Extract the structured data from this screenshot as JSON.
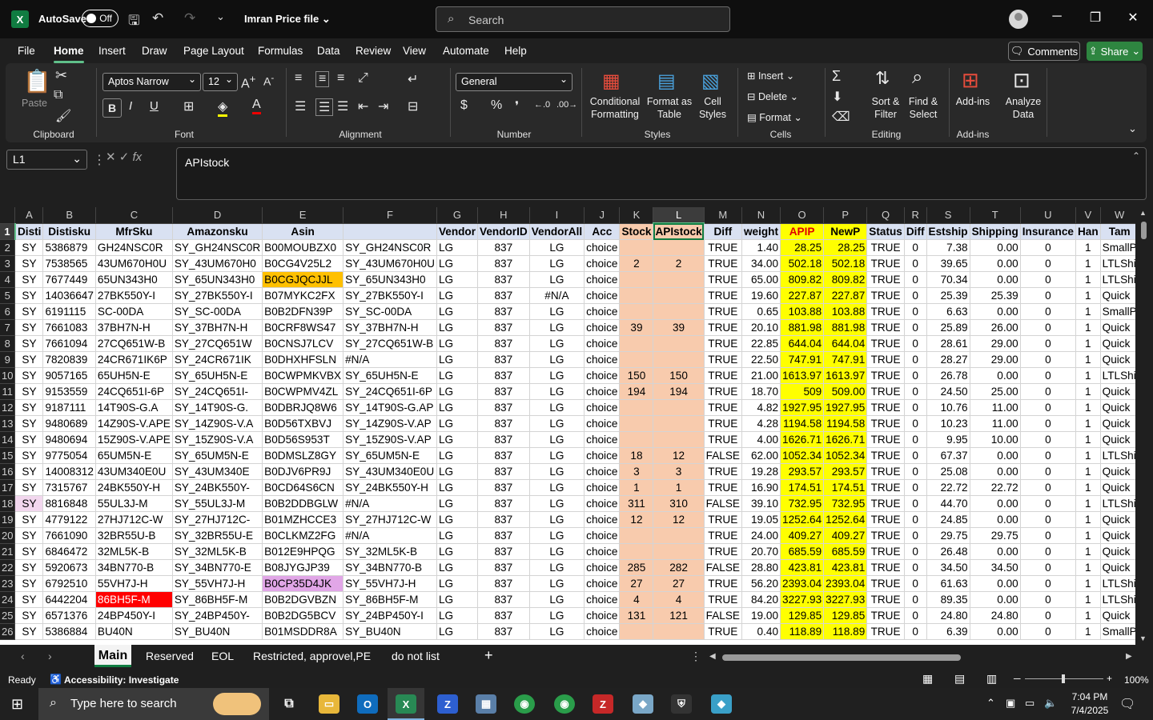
{
  "titlebar": {
    "autosave_label": "AutoSave",
    "autosave_state": "Off",
    "file_title": "Imran Price file",
    "search_placeholder": "Search"
  },
  "menu": {
    "items": [
      "File",
      "Home",
      "Insert",
      "Draw",
      "Page Layout",
      "Formulas",
      "Data",
      "Review",
      "View",
      "Automate",
      "Help"
    ],
    "comments": "Comments",
    "share": "Share"
  },
  "ribbon": {
    "clipboard": {
      "label": "Clipboard",
      "paste": "Paste"
    },
    "font": {
      "label": "Font",
      "name": "Aptos Narrow",
      "size": "12"
    },
    "alignment": {
      "label": "Alignment"
    },
    "number": {
      "label": "Number",
      "format": "General"
    },
    "styles": {
      "label": "Styles",
      "cond1": "Conditional",
      "cond2": "Formatting",
      "fmt1": "Format as",
      "fmt2": "Table",
      "cell1": "Cell",
      "cell2": "Styles"
    },
    "cells": {
      "label": "Cells",
      "insert": "Insert",
      "delete": "Delete",
      "format": "Format"
    },
    "editing": {
      "label": "Editing",
      "sort1": "Sort &",
      "sort2": "Filter",
      "find1": "Find &",
      "find2": "Select"
    },
    "addins": {
      "label": "Add-ins",
      "addins": "Add-ins",
      "analyze1": "Analyze",
      "analyze2": "Data"
    }
  },
  "formula_bar": {
    "name_box": "L1",
    "formula": "APIstock"
  },
  "grid": {
    "columns": [
      "A",
      "B",
      "C",
      "D",
      "E",
      "F",
      "G",
      "H",
      "I",
      "J",
      "K",
      "L",
      "M",
      "N",
      "O",
      "P",
      "Q",
      "R",
      "S",
      "T",
      "U",
      "V",
      "W"
    ],
    "header_row": [
      "Disti",
      "Distisku",
      "MfrSku",
      "Amazonsku",
      "Asin",
      "",
      "Vendor",
      "VendorID",
      "VendorAll",
      "Acc",
      "Stock",
      "APIstock",
      "Diff",
      "weight",
      "APIP",
      "NewP",
      "Status",
      "Diff",
      "Estship",
      "Shipping",
      "Insurance",
      "Han",
      "Tam"
    ],
    "rows": [
      [
        "2",
        "SY",
        "5386879",
        "GH24NSC0R",
        "SY_GH24NSC0R",
        "B00MOUBZX0",
        "SY_GH24NSC0R",
        "LG",
        "837",
        "LG",
        "choice",
        "",
        "",
        "TRUE",
        "1.40",
        "28.25",
        "28.25",
        "TRUE",
        "0",
        "7.38",
        "0.00",
        "0",
        "1",
        "SmallP"
      ],
      [
        "3",
        "SY",
        "7538565",
        "43UM670H0U",
        "SY_43UM670H0",
        "B0CG4V25L2",
        "SY_43UM670H0U",
        "LG",
        "837",
        "LG",
        "choice",
        "2",
        "2",
        "TRUE",
        "34.00",
        "502.18",
        "502.18",
        "TRUE",
        "0",
        "39.65",
        "0.00",
        "0",
        "1",
        "LTLShi"
      ],
      [
        "4",
        "SY",
        "7677449",
        "65UN343H0",
        "SY_65UN343H0",
        "B0CGJQCJJL",
        "SY_65UN343H0",
        "LG",
        "837",
        "LG",
        "choice",
        "",
        "",
        "TRUE",
        "65.00",
        "809.82",
        "809.82",
        "TRUE",
        "0",
        "70.34",
        "0.00",
        "0",
        "1",
        "LTLShi"
      ],
      [
        "5",
        "SY",
        "14036647",
        "27BK550Y-I",
        "SY_27BK550Y-I",
        "B07MYKC2FX",
        "SY_27BK550Y-I",
        "LG",
        "837",
        "#N/A",
        "choice",
        "",
        "",
        "TRUE",
        "19.60",
        "227.87",
        "227.87",
        "TRUE",
        "0",
        "25.39",
        "25.39",
        "0",
        "1",
        "Quick"
      ],
      [
        "6",
        "SY",
        "6191115",
        "SC-00DA",
        "SY_SC-00DA",
        "B0B2DFN39P",
        "SY_SC-00DA",
        "LG",
        "837",
        "LG",
        "choice",
        "",
        "",
        "TRUE",
        "0.65",
        "103.88",
        "103.88",
        "TRUE",
        "0",
        "6.63",
        "0.00",
        "0",
        "1",
        "SmallP"
      ],
      [
        "7",
        "SY",
        "7661083",
        "37BH7N-H",
        "SY_37BH7N-H",
        "B0CRF8WS47",
        "SY_37BH7N-H",
        "LG",
        "837",
        "LG",
        "choice",
        "39",
        "39",
        "TRUE",
        "20.10",
        "881.98",
        "881.98",
        "TRUE",
        "0",
        "25.89",
        "26.00",
        "0",
        "1",
        "Quick"
      ],
      [
        "8",
        "SY",
        "7661094",
        "27CQ651W-B",
        "SY_27CQ651W",
        "B0CNSJ7LCV",
        "SY_27CQ651W-B",
        "LG",
        "837",
        "LG",
        "choice",
        "",
        "",
        "TRUE",
        "22.85",
        "644.04",
        "644.04",
        "TRUE",
        "0",
        "28.61",
        "29.00",
        "0",
        "1",
        "Quick"
      ],
      [
        "9",
        "SY",
        "7820839",
        "24CR671IK6P",
        "SY_24CR671IK",
        "B0DHXHFSLN",
        "#N/A",
        "LG",
        "837",
        "LG",
        "choice",
        "",
        "",
        "TRUE",
        "22.50",
        "747.91",
        "747.91",
        "TRUE",
        "0",
        "28.27",
        "29.00",
        "0",
        "1",
        "Quick"
      ],
      [
        "10",
        "SY",
        "9057165",
        "65UH5N-E",
        "SY_65UH5N-E",
        "B0CWPMKVBX",
        "SY_65UH5N-E",
        "LG",
        "837",
        "LG",
        "choice",
        "150",
        "150",
        "TRUE",
        "21.00",
        "1613.97",
        "1613.97",
        "TRUE",
        "0",
        "26.78",
        "0.00",
        "0",
        "1",
        "LTLShi"
      ],
      [
        "11",
        "SY",
        "9153559",
        "24CQ651I-6P",
        "SY_24CQ651I-",
        "B0CWPMV4ZL",
        "SY_24CQ651I-6P",
        "LG",
        "837",
        "LG",
        "choice",
        "194",
        "194",
        "TRUE",
        "18.70",
        "509",
        "509.00",
        "TRUE",
        "0",
        "24.50",
        "25.00",
        "0",
        "1",
        "Quick"
      ],
      [
        "12",
        "SY",
        "9187111",
        "14T90S-G.A",
        "SY_14T90S-G.",
        "B0DBRJQ8W6",
        "SY_14T90S-G.AP",
        "LG",
        "837",
        "LG",
        "choice",
        "",
        "",
        "TRUE",
        "4.82",
        "1927.95",
        "1927.95",
        "TRUE",
        "0",
        "10.76",
        "11.00",
        "0",
        "1",
        "Quick"
      ],
      [
        "13",
        "SY",
        "9480689",
        "14Z90S-V.APE",
        "SY_14Z90S-V.A",
        "B0D56TXBVJ",
        "SY_14Z90S-V.AP",
        "LG",
        "837",
        "LG",
        "choice",
        "",
        "",
        "TRUE",
        "4.28",
        "1194.58",
        "1194.58",
        "TRUE",
        "0",
        "10.23",
        "11.00",
        "0",
        "1",
        "Quick"
      ],
      [
        "14",
        "SY",
        "9480694",
        "15Z90S-V.APE",
        "SY_15Z90S-V.A",
        "B0D56S953T",
        "SY_15Z90S-V.AP",
        "LG",
        "837",
        "LG",
        "choice",
        "",
        "",
        "TRUE",
        "4.00",
        "1626.71",
        "1626.71",
        "TRUE",
        "0",
        "9.95",
        "10.00",
        "0",
        "1",
        "Quick"
      ],
      [
        "15",
        "SY",
        "9775054",
        "65UM5N-E",
        "SY_65UM5N-E",
        "B0DMSLZ8GY",
        "SY_65UM5N-E",
        "LG",
        "837",
        "LG",
        "choice",
        "18",
        "12",
        "FALSE",
        "62.00",
        "1052.34",
        "1052.34",
        "TRUE",
        "0",
        "67.37",
        "0.00",
        "0",
        "1",
        "LTLShi"
      ],
      [
        "16",
        "SY",
        "14008312",
        "43UM340E0U",
        "SY_43UM340E",
        "B0DJV6PR9J",
        "SY_43UM340E0U",
        "LG",
        "837",
        "LG",
        "choice",
        "3",
        "3",
        "TRUE",
        "19.28",
        "293.57",
        "293.57",
        "TRUE",
        "0",
        "25.08",
        "0.00",
        "0",
        "1",
        "Quick"
      ],
      [
        "17",
        "SY",
        "7315767",
        "24BK550Y-H",
        "SY_24BK550Y-",
        "B0CD64S6CN",
        "SY_24BK550Y-H",
        "LG",
        "837",
        "LG",
        "choice",
        "1",
        "1",
        "TRUE",
        "16.90",
        "174.51",
        "174.51",
        "TRUE",
        "0",
        "22.72",
        "22.72",
        "0",
        "1",
        "Quick"
      ],
      [
        "18",
        "SY",
        "8816848",
        "55UL3J-M",
        "SY_55UL3J-M",
        "B0B2DDBGLW",
        "#N/A",
        "LG",
        "837",
        "LG",
        "choice",
        "311",
        "310",
        "FALSE",
        "39.10",
        "732.95",
        "732.95",
        "TRUE",
        "0",
        "44.70",
        "0.00",
        "0",
        "1",
        "LTLShi"
      ],
      [
        "19",
        "SY",
        "4779122",
        "27HJ712C-W",
        "SY_27HJ712C-",
        "B01MZHCCE3",
        "SY_27HJ712C-W",
        "LG",
        "837",
        "LG",
        "choice",
        "12",
        "12",
        "TRUE",
        "19.05",
        "1252.64",
        "1252.64",
        "TRUE",
        "0",
        "24.85",
        "0.00",
        "0",
        "1",
        "Quick"
      ],
      [
        "20",
        "SY",
        "7661090",
        "32BR55U-B",
        "SY_32BR55U-E",
        "B0CLKMZ2FG",
        "#N/A",
        "LG",
        "837",
        "LG",
        "choice",
        "",
        "",
        "TRUE",
        "24.00",
        "409.27",
        "409.27",
        "TRUE",
        "0",
        "29.75",
        "29.75",
        "0",
        "1",
        "Quick"
      ],
      [
        "21",
        "SY",
        "6846472",
        "32ML5K-B",
        "SY_32ML5K-B",
        "B012E9HPQG",
        "SY_32ML5K-B",
        "LG",
        "837",
        "LG",
        "choice",
        "",
        "",
        "TRUE",
        "20.70",
        "685.59",
        "685.59",
        "TRUE",
        "0",
        "26.48",
        "0.00",
        "0",
        "1",
        "Quick"
      ],
      [
        "22",
        "SY",
        "5920673",
        "34BN770-B",
        "SY_34BN770-E",
        "B08JYGJP39",
        "SY_34BN770-B",
        "LG",
        "837",
        "LG",
        "choice",
        "285",
        "282",
        "FALSE",
        "28.80",
        "423.81",
        "423.81",
        "TRUE",
        "0",
        "34.50",
        "34.50",
        "0",
        "1",
        "Quick"
      ],
      [
        "23",
        "SY",
        "6792510",
        "55VH7J-H",
        "SY_55VH7J-H",
        "B0CP35D4JK",
        "SY_55VH7J-H",
        "LG",
        "837",
        "LG",
        "choice",
        "27",
        "27",
        "TRUE",
        "56.20",
        "2393.04",
        "2393.04",
        "TRUE",
        "0",
        "61.63",
        "0.00",
        "0",
        "1",
        "LTLShi"
      ],
      [
        "24",
        "SY",
        "6442204",
        "86BH5F-M",
        "SY_86BH5F-M",
        "B0B2DGVBZN",
        "SY_86BH5F-M",
        "LG",
        "837",
        "LG",
        "choice",
        "4",
        "4",
        "TRUE",
        "84.20",
        "3227.93",
        "3227.93",
        "TRUE",
        "0",
        "89.35",
        "0.00",
        "0",
        "1",
        "LTLShi"
      ],
      [
        "25",
        "SY",
        "6571376",
        "24BP450Y-I",
        "SY_24BP450Y-",
        "B0B2DG5BCV",
        "SY_24BP450Y-I",
        "LG",
        "837",
        "LG",
        "choice",
        "131",
        "121",
        "FALSE",
        "19.00",
        "129.85",
        "129.85",
        "TRUE",
        "0",
        "24.80",
        "24.80",
        "0",
        "1",
        "Quick"
      ],
      [
        "26",
        "SY",
        "5386884",
        "BU40N",
        "SY_BU40N",
        "B01MSDDR8A",
        "SY_BU40N",
        "LG",
        "837",
        "LG",
        "choice",
        "",
        "",
        "TRUE",
        "0.40",
        "118.89",
        "118.89",
        "TRUE",
        "0",
        "6.39",
        "0.00",
        "0",
        "1",
        "SmallP"
      ]
    ]
  },
  "sheets": {
    "tabs": [
      "Main",
      "Reserved",
      "EOL",
      "Restricted, approvel,PE",
      "do not list"
    ],
    "active": "Main"
  },
  "status": {
    "ready": "Ready",
    "accessibility": "Accessibility: Investigate",
    "zoom": "100%"
  },
  "taskbar": {
    "search_placeholder": "Type here to search",
    "time": "7:04 PM",
    "date": "7/4/2025"
  },
  "colors": {
    "accent": "#107c41",
    "salmon": "#f8cbad",
    "yellow": "#ffff00",
    "orange": "#ffc000",
    "header_fill": "#d9e1f2",
    "red": "#ff0000"
  }
}
